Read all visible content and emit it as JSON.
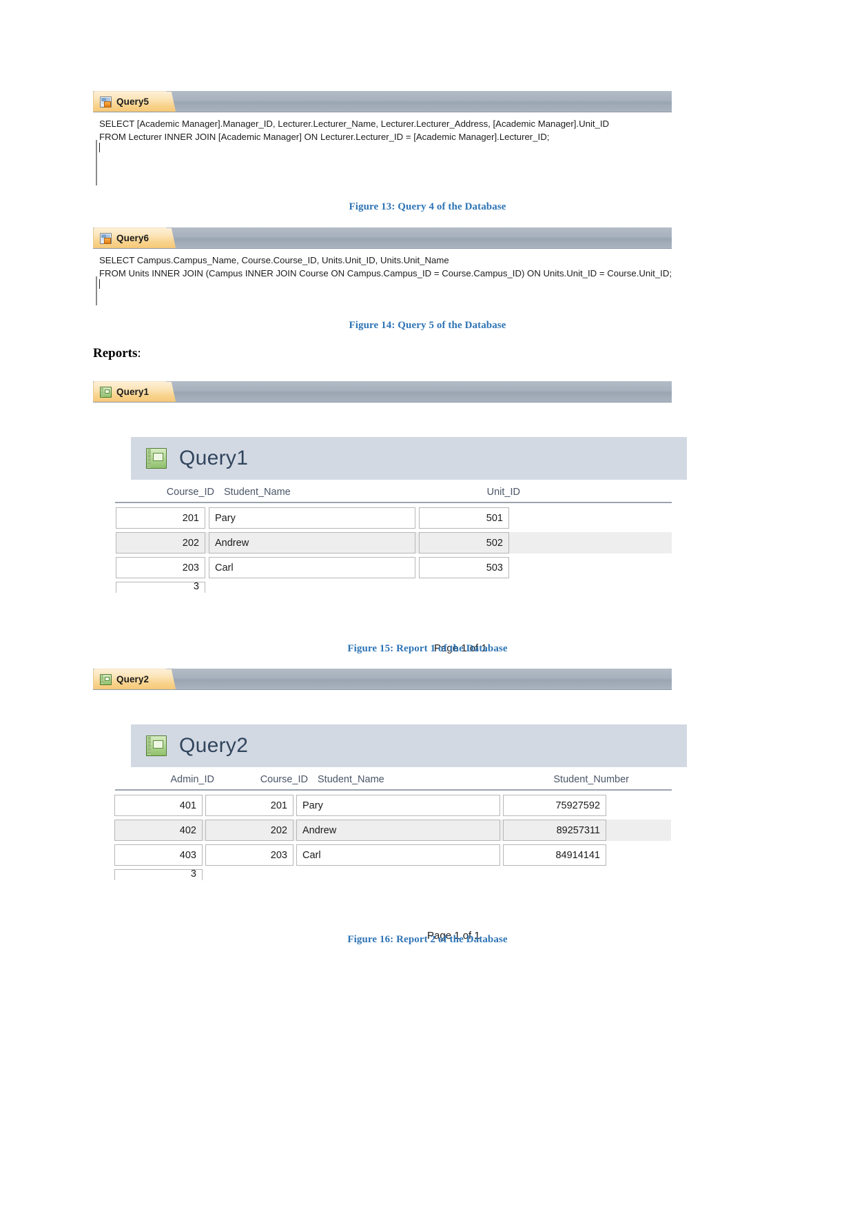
{
  "document": {
    "section_heading": "Reports",
    "section_heading_colon": ":"
  },
  "sql_panes": [
    {
      "tab_label": "Query5",
      "tab_icon": "query-icon",
      "line1": "SELECT [Academic Manager].Manager_ID, Lecturer.Lecturer_Name, Lecturer.Lecturer_Address, [Academic Manager].Unit_ID",
      "line2": "FROM Lecturer INNER JOIN [Academic Manager] ON Lecturer.Lecturer_ID = [Academic Manager].Lecturer_ID;",
      "caption": "Figure 13: Query 4 of the Database"
    },
    {
      "tab_label": "Query6",
      "tab_icon": "query-icon",
      "line1": "SELECT Campus.Campus_Name, Course.Course_ID, Units.Unit_ID, Units.Unit_Name",
      "line2": "FROM Units INNER JOIN (Campus INNER JOIN Course ON Campus.Campus_ID = Course.Campus_ID) ON Units.Unit_ID = Course.Unit_ID;",
      "caption": "Figure 14: Query 5 of the Database"
    }
  ],
  "reports": [
    {
      "tab_label": "Query1",
      "tab_icon": "report-icon",
      "report_title": "Query1",
      "columns": [
        "Course_ID",
        "Student_Name",
        "Unit_ID"
      ],
      "rows": [
        [
          "201",
          "Pary",
          "501"
        ],
        [
          "202",
          "Andrew",
          "502"
        ],
        [
          "203",
          "Carl",
          "503"
        ]
      ],
      "partial_row_value": "3",
      "page_footer": "Page 1 of 1",
      "caption": "Figure 15: Report 1 of the Database"
    },
    {
      "tab_label": "Query2",
      "tab_icon": "report-icon",
      "report_title": "Query2",
      "columns": [
        "Admin_ID",
        "Course_ID",
        "Student_Name",
        "Student_Number"
      ],
      "rows": [
        [
          "401",
          "201",
          "Pary",
          "75927592"
        ],
        [
          "402",
          "202",
          "Andrew",
          "89257311"
        ],
        [
          "403",
          "203",
          "Carl",
          "84914141"
        ]
      ],
      "partial_row_value": "3",
      "page_footer": "Page 1 of 1",
      "caption": "Figure 16: Report 2 of the Database"
    }
  ],
  "colors": {
    "caption_blue": "#2e74b5",
    "tab_orange": "#f8d28c",
    "tabstrip_gray": "#a7b1bd",
    "report_header_blue_gray": "#d3d9e3",
    "alt_row_gray": "#eeeeee"
  }
}
